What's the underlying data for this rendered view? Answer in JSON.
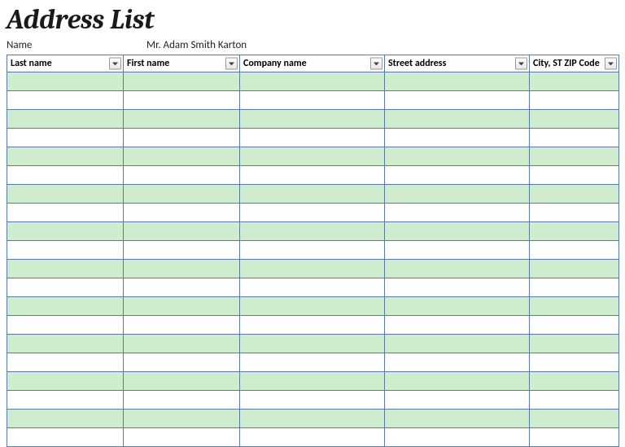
{
  "title": "Address List",
  "name_field": {
    "label": "Name",
    "value": "Mr. Adam Smith Karton"
  },
  "columns": [
    {
      "label": "Last name"
    },
    {
      "label": "First name"
    },
    {
      "label": "Company name"
    },
    {
      "label": "Street address"
    },
    {
      "label": "City, ST  ZIP Code"
    }
  ],
  "rows": [
    {
      "last_name": "",
      "first_name": "",
      "company_name": "",
      "street_address": "",
      "city_st_zip": ""
    },
    {
      "last_name": "",
      "first_name": "",
      "company_name": "",
      "street_address": "",
      "city_st_zip": ""
    },
    {
      "last_name": "",
      "first_name": "",
      "company_name": "",
      "street_address": "",
      "city_st_zip": ""
    },
    {
      "last_name": "",
      "first_name": "",
      "company_name": "",
      "street_address": "",
      "city_st_zip": ""
    },
    {
      "last_name": "",
      "first_name": "",
      "company_name": "",
      "street_address": "",
      "city_st_zip": ""
    },
    {
      "last_name": "",
      "first_name": "",
      "company_name": "",
      "street_address": "",
      "city_st_zip": ""
    },
    {
      "last_name": "",
      "first_name": "",
      "company_name": "",
      "street_address": "",
      "city_st_zip": ""
    },
    {
      "last_name": "",
      "first_name": "",
      "company_name": "",
      "street_address": "",
      "city_st_zip": ""
    },
    {
      "last_name": "",
      "first_name": "",
      "company_name": "",
      "street_address": "",
      "city_st_zip": ""
    },
    {
      "last_name": "",
      "first_name": "",
      "company_name": "",
      "street_address": "",
      "city_st_zip": ""
    },
    {
      "last_name": "",
      "first_name": "",
      "company_name": "",
      "street_address": "",
      "city_st_zip": ""
    },
    {
      "last_name": "",
      "first_name": "",
      "company_name": "",
      "street_address": "",
      "city_st_zip": ""
    },
    {
      "last_name": "",
      "first_name": "",
      "company_name": "",
      "street_address": "",
      "city_st_zip": ""
    },
    {
      "last_name": "",
      "first_name": "",
      "company_name": "",
      "street_address": "",
      "city_st_zip": ""
    },
    {
      "last_name": "",
      "first_name": "",
      "company_name": "",
      "street_address": "",
      "city_st_zip": ""
    },
    {
      "last_name": "",
      "first_name": "",
      "company_name": "",
      "street_address": "",
      "city_st_zip": ""
    },
    {
      "last_name": "",
      "first_name": "",
      "company_name": "",
      "street_address": "",
      "city_st_zip": ""
    },
    {
      "last_name": "",
      "first_name": "",
      "company_name": "",
      "street_address": "",
      "city_st_zip": ""
    },
    {
      "last_name": "",
      "first_name": "",
      "company_name": "",
      "street_address": "",
      "city_st_zip": ""
    },
    {
      "last_name": "",
      "first_name": "",
      "company_name": "",
      "street_address": "",
      "city_st_zip": ""
    }
  ]
}
